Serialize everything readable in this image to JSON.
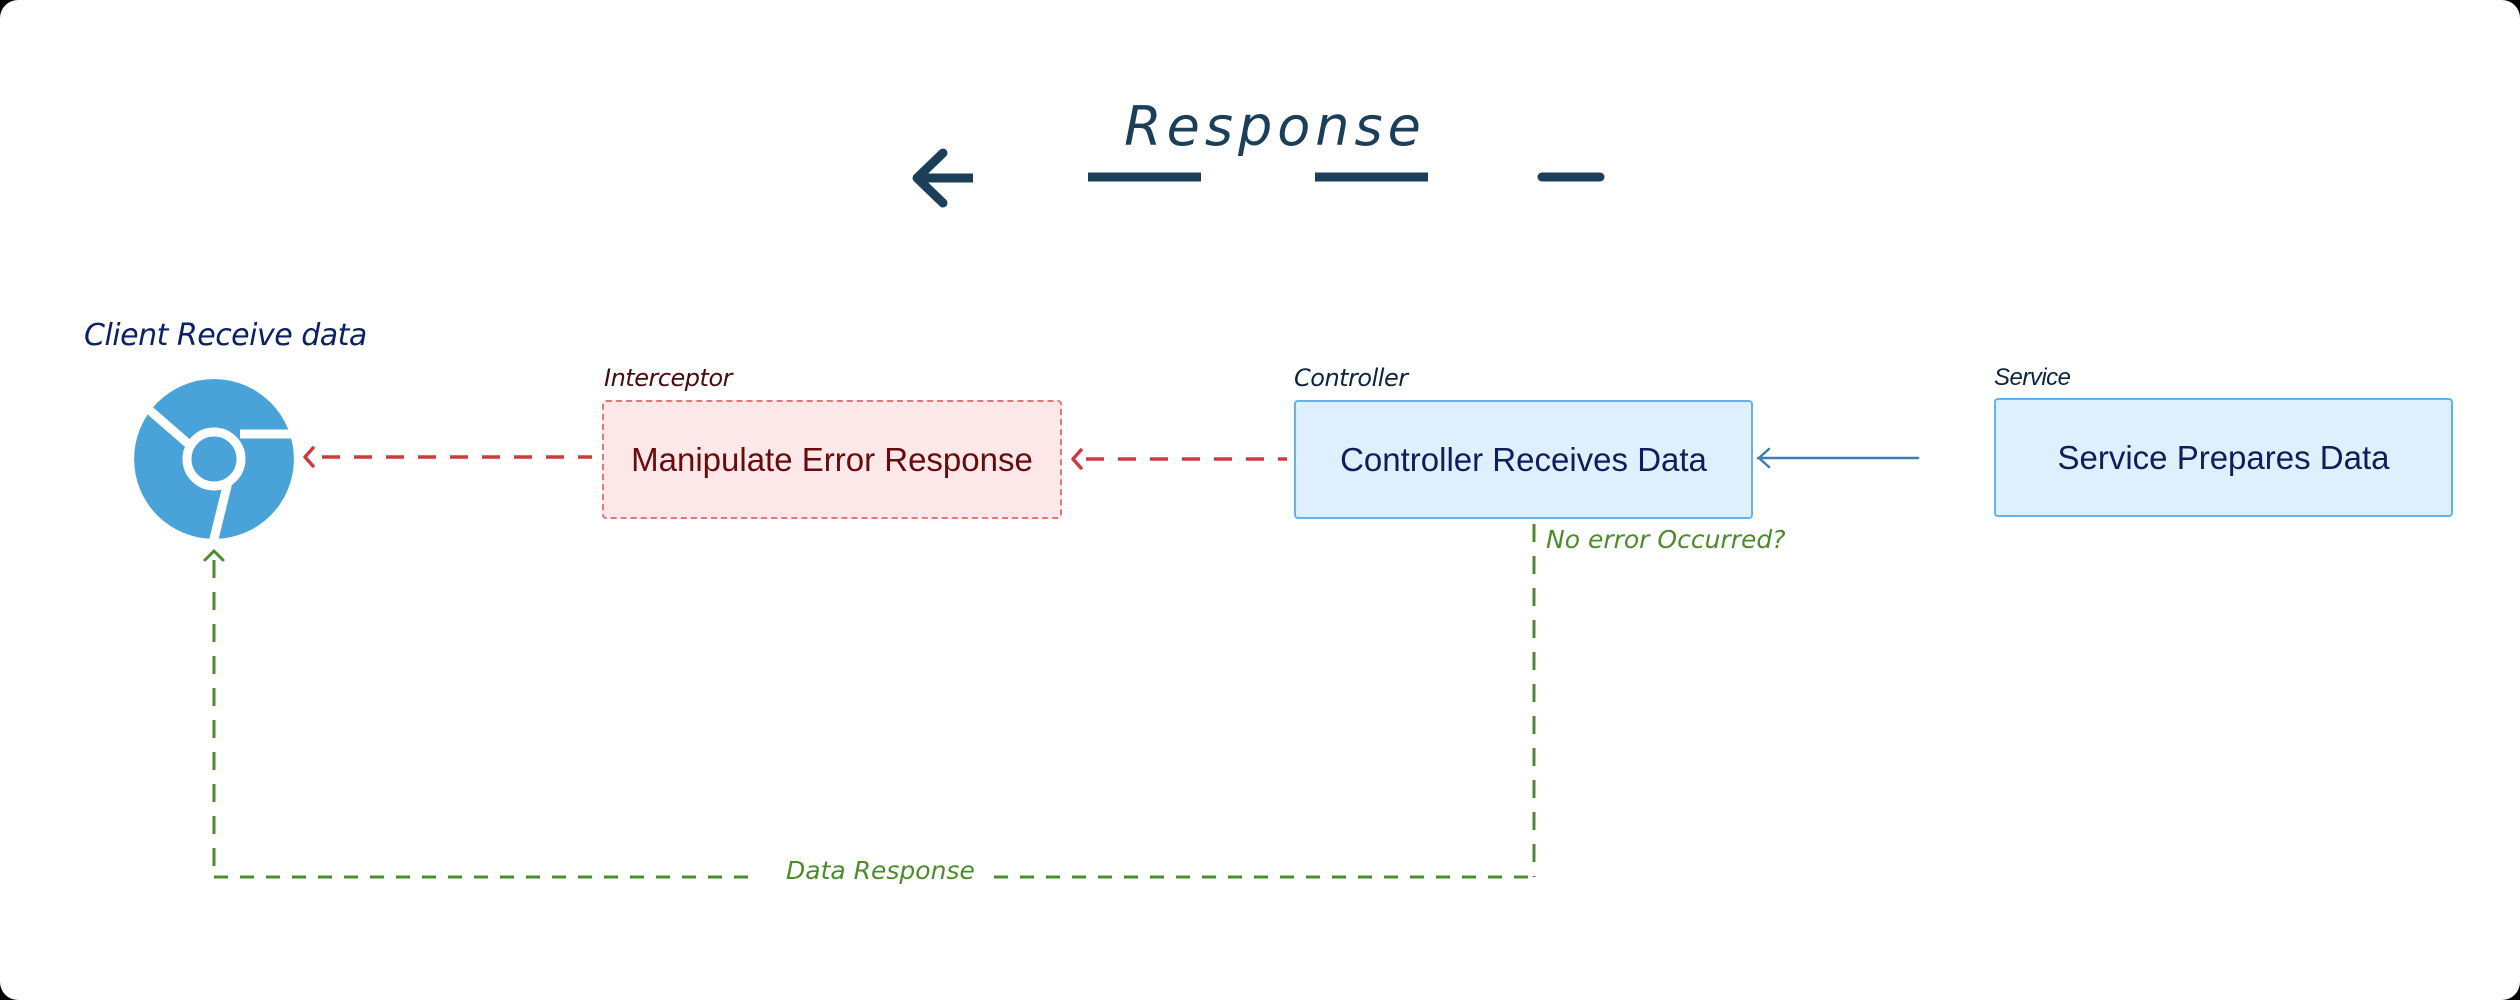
{
  "diagram": {
    "title": "Response",
    "title_direction_icon": "arrow-left-icon",
    "colors": {
      "title": "#1b3f58",
      "client_icon": "#4aa3d8",
      "error_path": "#d0393f",
      "success_path": "#4b8c2b",
      "service_flow": "#3d7fb5",
      "interceptor_fill": "#fde8e9",
      "interceptor_border": "#e4777a",
      "box_fill": "#dfeffd",
      "box_border": "#62b3ee"
    },
    "client": {
      "label": "Client Receive data",
      "icon": "chromium-browser-icon"
    },
    "nodes": [
      {
        "id": "interceptor",
        "group_label": "Interceptor",
        "text": "Manipulate Error Response",
        "style": "dashed-red"
      },
      {
        "id": "controller",
        "group_label": "Controller",
        "text": "Controller Receives Data",
        "style": "solid-blue"
      },
      {
        "id": "service",
        "group_label": "Service",
        "text": "Service Prepares Data",
        "style": "solid-blue"
      }
    ],
    "edges": [
      {
        "from": "service",
        "to": "controller",
        "style": "solid",
        "label": ""
      },
      {
        "from": "controller",
        "to": "interceptor",
        "style": "dashed-red",
        "label": ""
      },
      {
        "from": "interceptor",
        "to": "client",
        "style": "dashed-red",
        "label": ""
      },
      {
        "from": "controller",
        "to": "client",
        "style": "dashed-green",
        "label": "Data Response",
        "condition": "No error Occurred?"
      }
    ]
  }
}
